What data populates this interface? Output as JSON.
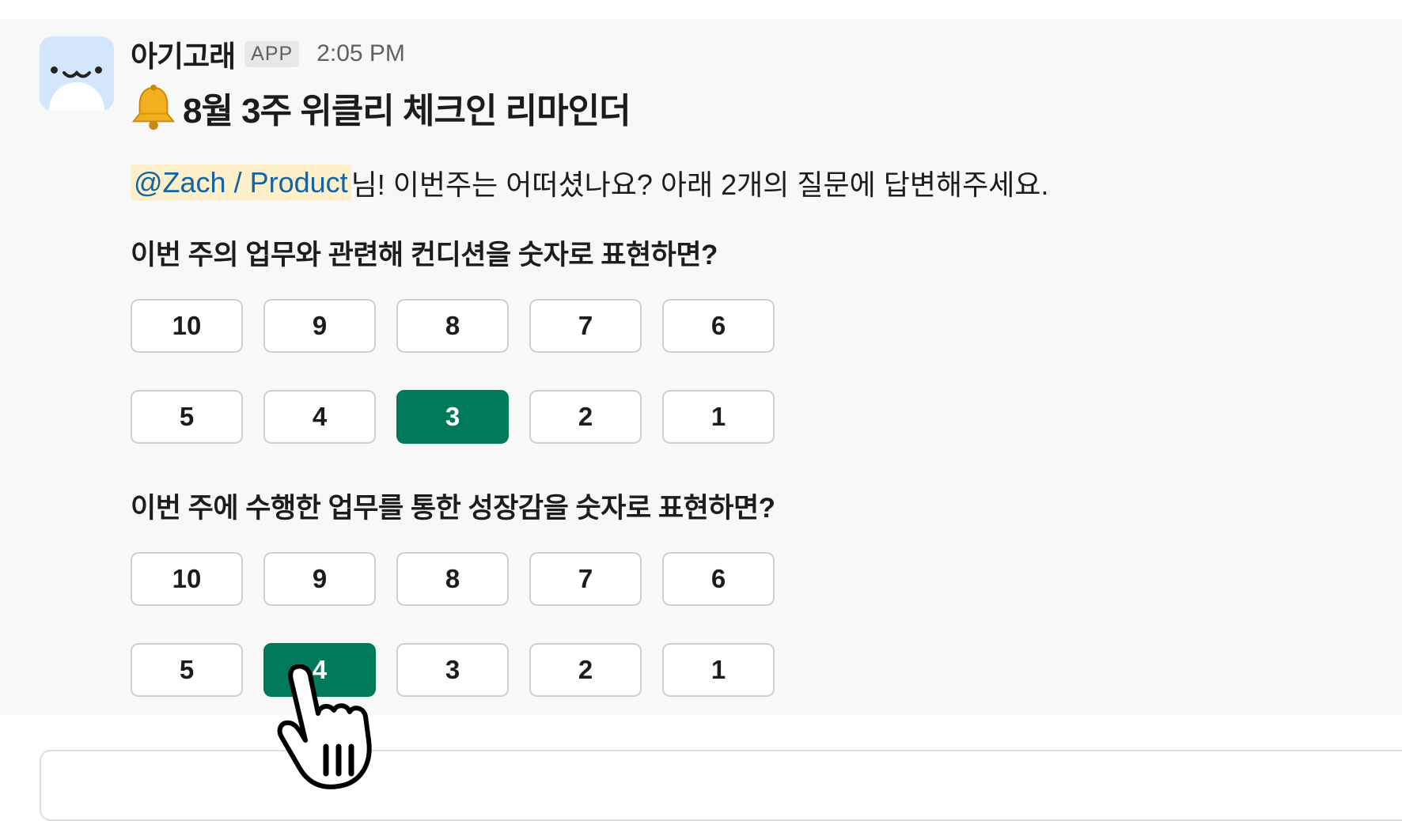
{
  "message": {
    "sender": "아기고래",
    "badge": "APP",
    "time": "2:05 PM",
    "title_emoji": "bell-icon",
    "title": "8월 3주 위클리 체크인 리마인더",
    "mention": "@Zach / Product",
    "intro": "님! 이번주는 어떠셨나요? 아래 2개의 질문에 답변해주세요.",
    "questions": [
      {
        "text": "이번 주의 업무와 관련해 컨디션을 숫자로 표현하면?",
        "options": [
          "10",
          "9",
          "8",
          "7",
          "6",
          "5",
          "4",
          "3",
          "2",
          "1"
        ],
        "selected": "3"
      },
      {
        "text": "이번 주에 수행한 업무를 통한 성장감을 숫자로 표현하면?",
        "options": [
          "10",
          "9",
          "8",
          "7",
          "6",
          "5",
          "4",
          "3",
          "2",
          "1"
        ],
        "selected": "4"
      }
    ]
  },
  "colors": {
    "selected": "#007a5a",
    "mention_bg": "#fcefc9",
    "mention_text": "#1264a3",
    "avatar_bg": "#d3e6fc"
  },
  "icons": {
    "avatar": "whale-face-icon",
    "cursor": "hand-pointer-cursor-icon"
  }
}
